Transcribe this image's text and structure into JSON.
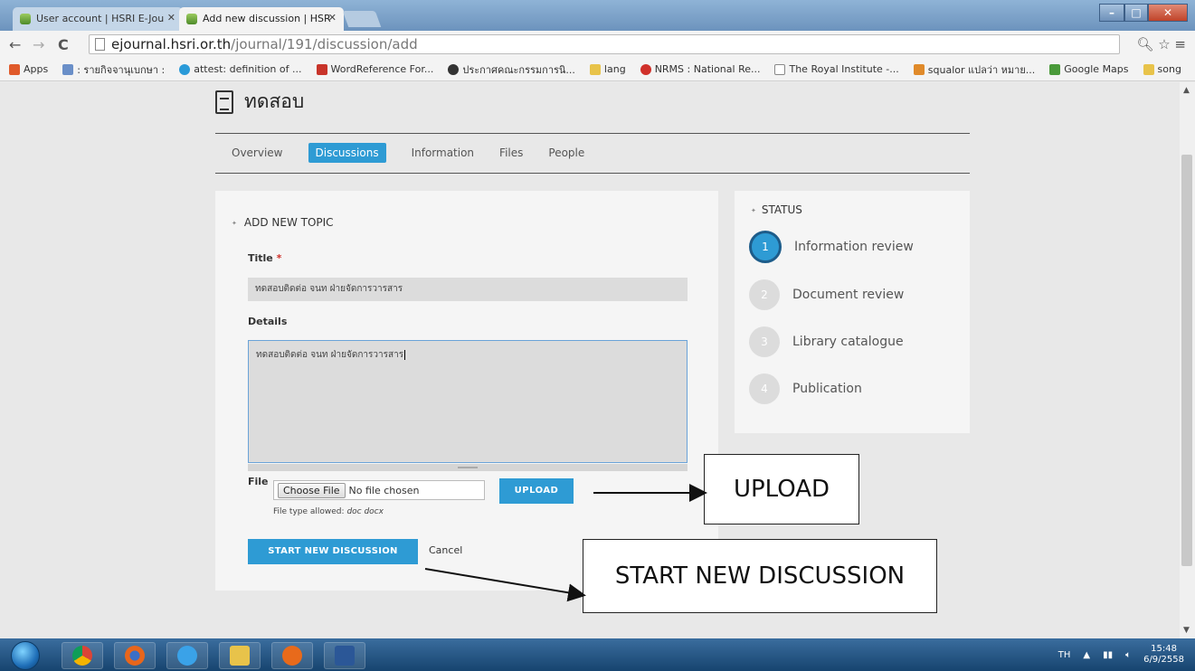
{
  "browser": {
    "tabs": [
      {
        "label": "User account | HSRI E-Jou"
      },
      {
        "label": "Add new discussion | HSR"
      }
    ],
    "url_host": "ejournal.hsri.or.th",
    "url_path": "/journal/191/discussion/add",
    "bookmarks": [
      {
        "label": "Apps",
        "color": "#e05a2a"
      },
      {
        "label": ": รายกิจจานุเบกษา :",
        "color": "#6a8fc8"
      },
      {
        "label": "attest: definition of ...",
        "color": "#2a9ad8"
      },
      {
        "label": "WordReference For...",
        "color": "#c8342a"
      },
      {
        "label": "ประกาศคณะกรรมการนิ...",
        "color": "#333333"
      },
      {
        "label": "lang",
        "color": "#e8c34a"
      },
      {
        "label": "NRMS : National Re...",
        "color": "#d0302a"
      },
      {
        "label": "The Royal Institute -...",
        "color": "#ffffff"
      },
      {
        "label": "squalor แปลว่า หมาย...",
        "color": "#e08a2a"
      },
      {
        "label": "Google Maps",
        "color": "#4a9a3a"
      },
      {
        "label": "song",
        "color": "#e8c34a"
      }
    ]
  },
  "page": {
    "title": "ทดสอบ",
    "nav_tabs": [
      {
        "label": "Overview",
        "active": false
      },
      {
        "label": "Discussions",
        "active": true
      },
      {
        "label": "Information",
        "active": false
      },
      {
        "label": "Files",
        "active": false
      },
      {
        "label": "People",
        "active": false
      }
    ]
  },
  "form": {
    "section_title": "ADD NEW TOPIC",
    "title_label": "Title",
    "required_mark": "*",
    "title_value": "ทดสอบติดต่อ จนท ฝ่ายจัดการวารสาร",
    "details_label": "Details",
    "details_value": "ทดสอบติดต่อ จนท ฝ่ายจัดการวารสาร",
    "file_label": "File",
    "choose_file_label": "Choose File",
    "file_status": "No file chosen",
    "upload_label": "UPLOAD",
    "file_allowed_prefix": "File type allowed:",
    "file_allowed_types": "doc docx",
    "start_label": "START NEW DISCUSSION",
    "cancel_label": "Cancel"
  },
  "status": {
    "title": "STATUS",
    "steps": [
      {
        "num": "1",
        "label": "Information review",
        "active": true
      },
      {
        "num": "2",
        "label": "Document review",
        "active": false
      },
      {
        "num": "3",
        "label": "Library catalogue",
        "active": false
      },
      {
        "num": "4",
        "label": "Publication",
        "active": false
      }
    ]
  },
  "callouts": {
    "upload": "UPLOAD",
    "start": "START NEW DISCUSSION"
  },
  "taskbar": {
    "lang": "TH",
    "time": "15:48",
    "date": "6/9/2558"
  }
}
